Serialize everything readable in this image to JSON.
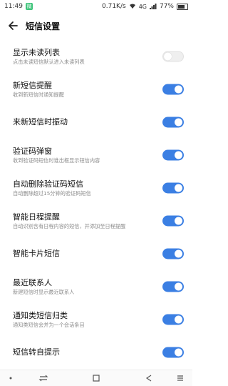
{
  "status_bar": {
    "time": "11:49",
    "app_badge": "微",
    "net_speed": "0.71K/s",
    "network": "4G",
    "battery": "77%",
    "battery_level": 0.77
  },
  "header": {
    "title": "短信设置"
  },
  "settings": [
    {
      "title": "显示未读列表",
      "subtitle": "点击未读短信默认进入未读列表",
      "on": false
    },
    {
      "title": "新短信提醒",
      "subtitle": "收到新短信时通知提醒",
      "on": true
    },
    {
      "title": "来新短信时振动",
      "subtitle": "",
      "on": true
    },
    {
      "title": "验证码弹窗",
      "subtitle": "收到验证码短信时谁出框显示短信内容",
      "on": true
    },
    {
      "title": "自动删除验证码短信",
      "subtitle": "自动删除超过15分钟的验证码短信",
      "on": true
    },
    {
      "title": "智能日程提醒",
      "subtitle": "自动识别含有日程内容的短信，并添加至日程提醒",
      "on": true
    },
    {
      "title": "智能卡片短信",
      "subtitle": "",
      "on": true
    },
    {
      "title": "最近联系人",
      "subtitle": "新建短信时显示最近联系人",
      "on": true
    },
    {
      "title": "通知类短信归类",
      "subtitle": "通知类短信会并为一个会话条目",
      "on": true
    },
    {
      "title": "短信转自提示",
      "subtitle": "",
      "on": true
    }
  ],
  "colors": {
    "accent": "#3b7fe3",
    "toggle_off": "#efefef"
  },
  "icons": {
    "back": "back-arrow-icon",
    "nav": [
      "dot-icon",
      "switch-icon",
      "square-icon",
      "back-triangle-icon",
      "menu-icon"
    ]
  }
}
